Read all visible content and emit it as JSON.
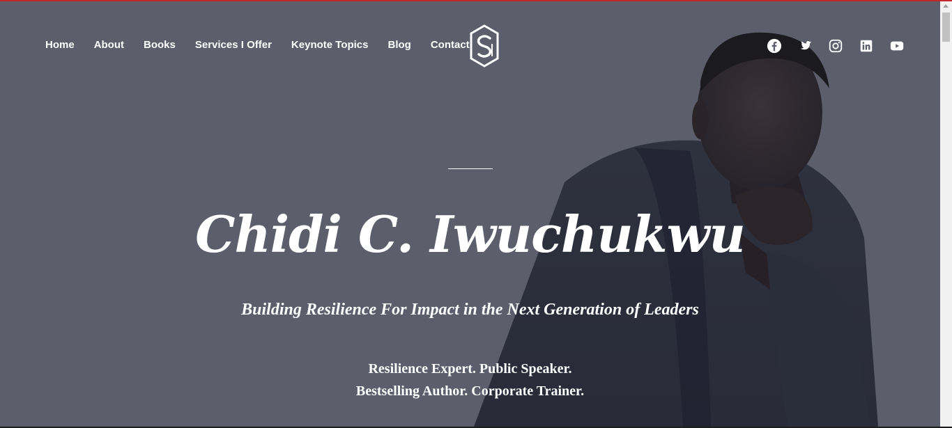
{
  "nav": {
    "items": [
      {
        "label": "Home"
      },
      {
        "label": "About"
      },
      {
        "label": "Books"
      },
      {
        "label": "Services I Offer"
      },
      {
        "label": "Keynote Topics"
      },
      {
        "label": "Blog"
      },
      {
        "label": "Contact"
      }
    ]
  },
  "logo": {
    "icon": "cs-monogram-logo"
  },
  "social": {
    "icons": [
      "facebook-icon",
      "twitter-icon",
      "instagram-icon",
      "linkedin-icon",
      "youtube-icon"
    ]
  },
  "hero": {
    "title": "Chidi C. Iwuchukwu",
    "subtitle": "Building Resilience For Impact in the Next Generation of Leaders",
    "roles_line1": "Resilience Expert. Public Speaker.",
    "roles_line2": "Bestselling Author. Corporate Trainer."
  },
  "colors": {
    "overlay": "#5c5f6b",
    "text": "#ffffff",
    "top_border": "#c1272d"
  }
}
